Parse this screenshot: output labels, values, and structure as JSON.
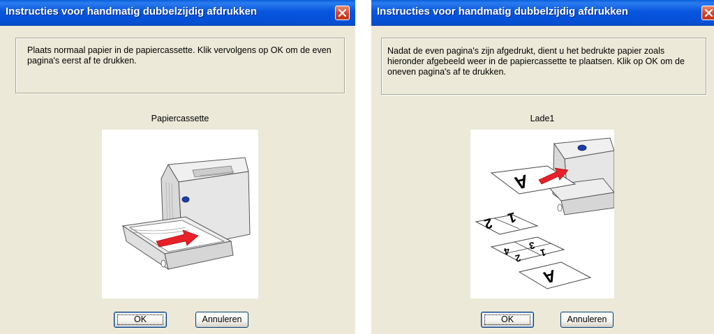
{
  "dialog_left": {
    "title": "Instructies voor handmatig dubbelzijdig afdrukken",
    "instruction": "Plaats normaal papier in de papiercassette. Klik vervolgens op OK om de even pagina's eerst af te drukken.",
    "caption": "Papiercassette",
    "ok_label": "OK",
    "cancel_label": "Annuleren"
  },
  "dialog_right": {
    "title": "Instructies voor handmatig dubbelzijdig afdrukken",
    "instruction": "Nadat de even pagina's zijn afgedrukt, dient u het bedrukte papier zoals hieronder afgebeeld weer in de papiercassette te plaatsen. Klik op OK om de oneven pagina's af te drukken.",
    "caption": "Lade1",
    "ok_label": "OK",
    "cancel_label": "Annuleren",
    "illustration_letters": {
      "big_a": "A",
      "page_2": "2",
      "page_1": "1",
      "page_3": "3",
      "page_4": "4",
      "page_1b": "1",
      "page_2b": "2",
      "bottom_a": "A"
    }
  },
  "colors": {
    "titlebar": "#0857de",
    "dialog_bg": "#ece9d8",
    "close_button": "#d3442a",
    "arrow_red": "#e8202a",
    "printer_blue": "#1a3fa8"
  },
  "icons": {
    "close": "close-x-icon"
  }
}
